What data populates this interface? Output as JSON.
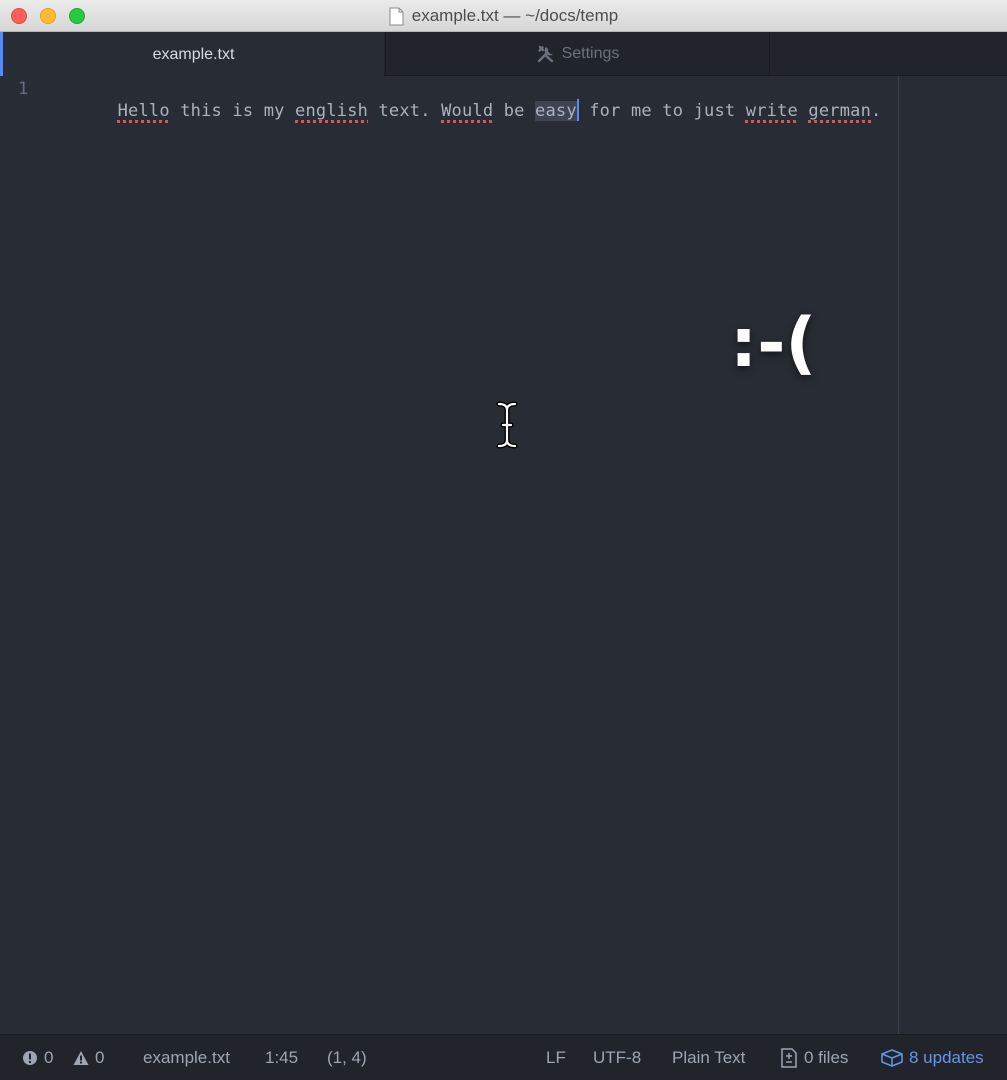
{
  "window": {
    "title": "example.txt — ~/docs/temp"
  },
  "tabs": [
    {
      "label": "example.txt",
      "active": true
    },
    {
      "label": "Settings",
      "active": false,
      "icon": "tools-icon"
    }
  ],
  "editor": {
    "line_number": "1",
    "segments": [
      {
        "text": "Hello",
        "misspelled": true
      },
      {
        "text": " this is my "
      },
      {
        "text": "english",
        "misspelled": true
      },
      {
        "text": " text. "
      },
      {
        "text": "Would",
        "misspelled": true
      },
      {
        "text": " be "
      },
      {
        "text": "easy",
        "selected": true
      },
      {
        "text": " for me to just "
      },
      {
        "text": "write",
        "misspelled": true
      },
      {
        "text": " "
      },
      {
        "text": "german",
        "misspelled": true
      },
      {
        "text": "."
      }
    ],
    "overlay_text": ":-("
  },
  "status_bar": {
    "errors": "0",
    "warnings": "0",
    "filename": "example.txt",
    "cursor_position": "1:45",
    "selection": "(1, 4)",
    "line_ending": "LF",
    "encoding": "UTF-8",
    "grammar": "Plain Text",
    "git_files": "0 files",
    "updates": "8 updates"
  },
  "colors": {
    "background": "#282c34",
    "panel": "#21252b",
    "accent": "#528bff",
    "misspelling": "#e05252",
    "updates": "#6494ed"
  }
}
